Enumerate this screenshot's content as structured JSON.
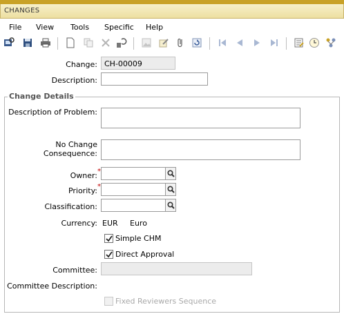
{
  "window": {
    "title": "CHANGES"
  },
  "menu": [
    {
      "label": "File"
    },
    {
      "label": "View"
    },
    {
      "label": "Tools"
    },
    {
      "label": "Specific"
    },
    {
      "label": "Help"
    }
  ],
  "toolbar": [
    {
      "name": "search-screen-icon"
    },
    {
      "name": "save-icon"
    },
    {
      "name": "print-icon"
    },
    {
      "name": "new-document-icon"
    },
    {
      "name": "copy-icon"
    },
    {
      "name": "delete-icon"
    },
    {
      "name": "undo-icon"
    },
    {
      "name": "image-icon"
    },
    {
      "name": "edit-note-icon"
    },
    {
      "name": "attachment-icon"
    },
    {
      "name": "refresh-icon"
    },
    {
      "name": "first-record-icon"
    },
    {
      "name": "previous-record-icon"
    },
    {
      "name": "next-record-icon"
    },
    {
      "name": "last-record-icon"
    },
    {
      "name": "details-icon"
    },
    {
      "name": "clock-icon"
    },
    {
      "name": "workflow-icon"
    }
  ],
  "header": {
    "change_label": "Change:",
    "change_value": "CH-00009",
    "description_label": "Description:",
    "description_value": ""
  },
  "details": {
    "legend": "Change Details",
    "problem_label": "Description of Problem:",
    "problem_value": "",
    "consequence_label": "No Change Consequence:",
    "consequence_value": "",
    "owner_label": "Owner:",
    "owner_value": "",
    "priority_label": "Priority:",
    "priority_value": "",
    "classification_label": "Classification:",
    "classification_value": "",
    "currency_label": "Currency:",
    "currency_code": "EUR",
    "currency_name": "Euro",
    "simple_chm_label": "Simple CHM",
    "simple_chm_checked": true,
    "direct_approval_label": "Direct Approval",
    "direct_approval_checked": true,
    "committee_label": "Committee:",
    "committee_value": "",
    "committee_description_label": "Committee Description:",
    "fixed_reviewers_label": "Fixed Reviewers Sequence",
    "fixed_reviewers_checked": false
  },
  "colors": {
    "title_bar": "#eddfa1",
    "title_accent": "#c9a227",
    "required_marker": "#c00000"
  }
}
